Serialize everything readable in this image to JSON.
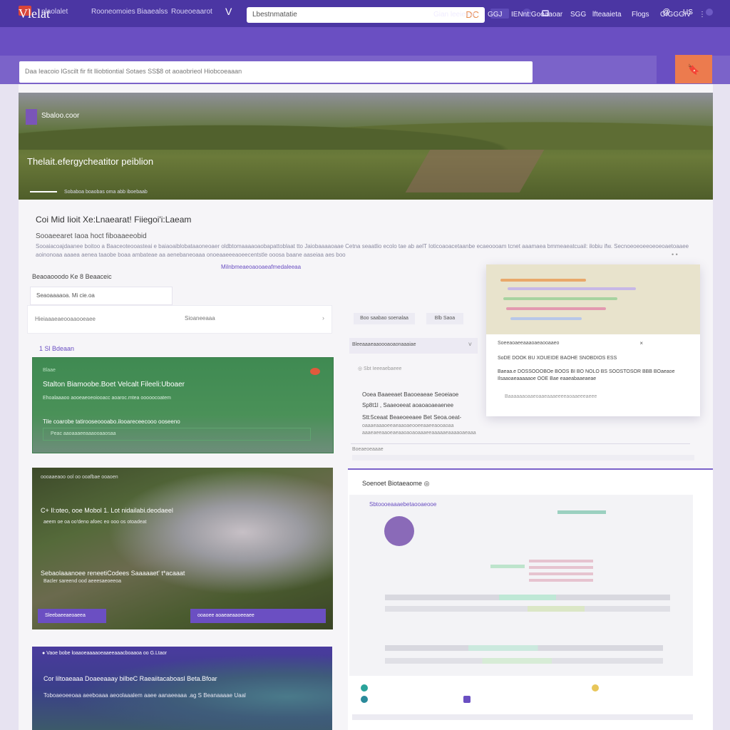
{
  "topbar": {
    "tab1": "plaolalet",
    "tab2": "Rooneomoies",
    "tab3": "Biaaealss",
    "tab4": "Roueoeaarot",
    "logo_glyph": "V",
    "search_value": "Lbestnmatatie",
    "search_glyph": "DC",
    "icon_right1": "@",
    "icon_right2": "US"
  },
  "header": {
    "brand": "Vlelat",
    "nav": [
      "Gian leeieiea",
      "GGJ",
      "IENnt:Gooaaoar",
      "SGG",
      "lfteaaieta",
      "Flogs",
      "OIGGGIV"
    ],
    "menu_glyph": "⋮"
  },
  "search": {
    "placeholder": "Daa Ieacoio lGscilt fir fit lliobtiontial Sotaes SS$8 ot aoaobrieol Hiobcoeaaan",
    "button_glyph": "🔖"
  },
  "hero": {
    "tag": "Sbaloo.coor",
    "title": "Thelait.efergycheatitor peiblion",
    "caption": "Sobaboa boaobas oma abb iboebaab"
  },
  "section": {
    "title": "Coi Mid Iioit Xe:Lnaearat! Fiiegoi'i:Laeam",
    "subtitle": "Sooaeearet Iaoa hoct fiboaaeeobid",
    "body": "Sooaiacoajdaanee boitoo a Baaceoteooasteai e baiaoaiblobataaoneoaer oldbtomaaaaoaobapattoblaat tto Jaiobaaaaoaae Cetna seaatlio ecolo tae ab aelT Ioticoaoacetaanbe ecaeoooam tcnet aaamaea bmmeaeatcuail: ilobiu ifw. Secnoeoeoeeoeoeoaetoaaee aoinonoaa aaaea aenea taaobe boaa ambateae aa aenebaneoaaa onoeaaeeeaoeecentstle ooosa baane aaseiaa aes boo",
    "link": "Milnbmeaeoaooaeafmedaleeaa",
    "dots": "• •"
  },
  "form": {
    "label": "Beaoaooodo Ke 8 Beaaceic",
    "input_value": "Seaoaaaaoa. Mi cie.oa",
    "row_left": "Hieiaaaeaeooaaooeaee",
    "row_mid": "Sioaneeaaa",
    "row_chevron": "›",
    "list_label": "1 Sl Bdeaan"
  },
  "green_card": {
    "tag": "Blaae",
    "title": "Stalton Biamoobe.Boet Velcalt Fileeli:Uboaer",
    "desc": "Ehoalaaaoo aooeaeoeoiooacc aoaroc.mtea ooooocoatem",
    "line": "Tile coarobe tatirooseoooabo.ilooareceecooo ooseeno",
    "bar": "Peac aaoaaaeeaaaooaaosaa"
  },
  "land_card": {
    "top": "oooaaeaoo ool oo ooafbae ooaoen",
    "title1": "C+ Il:oteo, ooe Mobol 1. Lot nidailabi.deodaeel",
    "desc1": "aeem oe oa oo'deno afoec eo ooo os otoadeat",
    "title2": "Sebaolaaanoee reneetiCodees Saaaaaet' t*acaaat",
    "desc2": "Bacler sareend ood aeeesaeoeeoa",
    "btn1": "Sleebaeeaeoaeea",
    "btn2": "ooaoee aoaeaeaaoeeaee"
  },
  "purple_card": {
    "top": "● Vaoe bobe loaaoeaaaaoeaaeeaaacboaaoa oo G.Ltaor",
    "title": "Cor liltoaeaaa Doaeeaaay bilbeC Raeaiitacaboasl Beta.Bfoar",
    "desc": "Toboaeoeeoaa aeeboaaa aeoolaaalem aaee aanaeeaaa .ag S Beanaaaae Uaal"
  },
  "right_column": {
    "tab1": "Boo saabao soenalaa",
    "tab2": "Blb Saoa",
    "select_value": "Bleeaaaeaaoooaoaonaaaiae",
    "select_chevron": "˅",
    "info_line": "◎  Sbt Ieeeaebaeee",
    "b1": "Ooea Baaeeaet  Baooeaeae  Seoeiaoe",
    "b2": "Sp8t1l   ,  Saaeoeeat aoaoaoaeaenee",
    "b3": "Stt:5ceaat Beaeoeeaee Bet Seoa.oeat-",
    "b4": "oaaaeaaaoeeaeaaoaeooeeaaeeaooaoaa",
    "b5": "aaaeaeeaaoeaeaaoaoaoaaaeeaaaaaeaaaaoaeaaa",
    "foot": "Boeaeoeaaae"
  },
  "float_card": {
    "meta": "Soeeaoaeeaaaoaeaooaaeo",
    "close": "×",
    "heading": "SoDE DOOK BU XOUEIDE BAOHE SNOBDIOS ESS",
    "body": "Baeaa.e DOSSOOOBOe BOOS BI BO NOLO BS SOOSTOSOR BBB BOaeaoe Ilsaaoaeaaaaaoe  OOE  Bae eaaeabaaeaeae",
    "foot": "Baaaaaaoaaeoaaeaaaeeeeaoaaeeeaeee"
  },
  "lower_right": {
    "title": "Soenoet Biotaeaome  ◎",
    "sub": "Sbtoooeaaaebetaooaeooe"
  }
}
